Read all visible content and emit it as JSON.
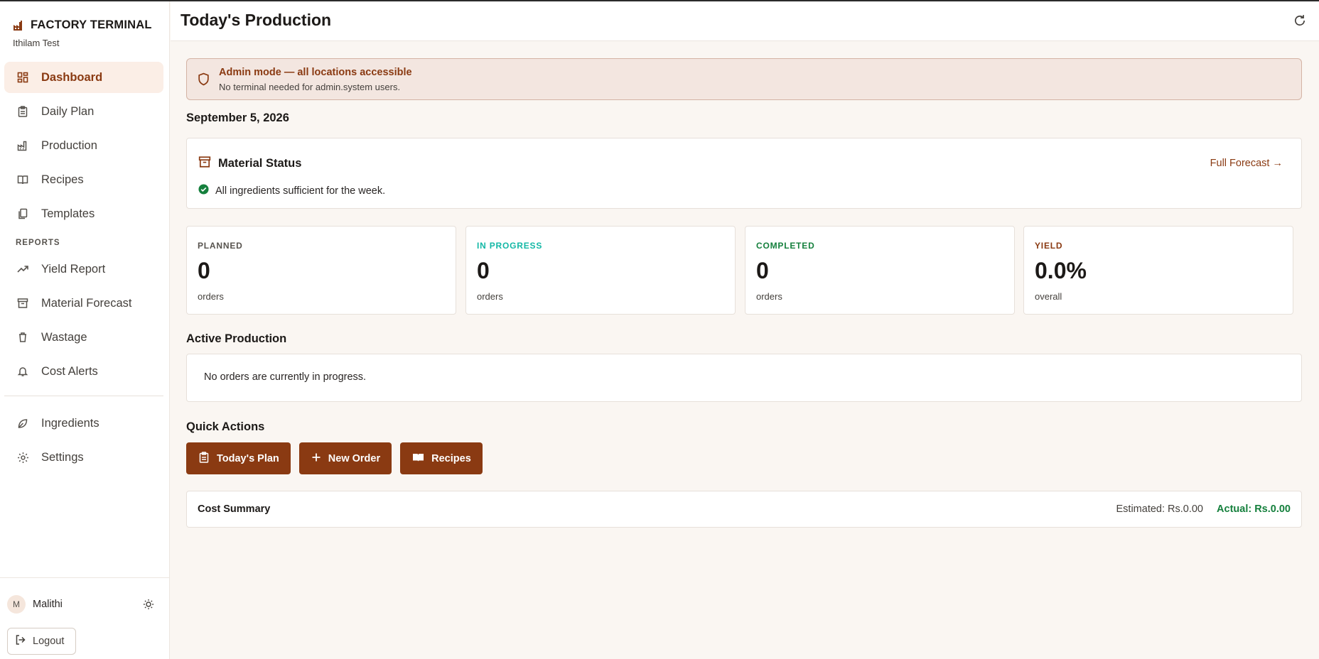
{
  "app": {
    "brand_title": "FACTORY TERMINAL",
    "location": "Ithilam Test"
  },
  "sidebar": {
    "main_items": [
      {
        "label": "Dashboard",
        "icon": "dashboard-icon",
        "active": true
      },
      {
        "label": "Daily Plan",
        "icon": "clipboard-icon"
      },
      {
        "label": "Production",
        "icon": "factory-icon"
      },
      {
        "label": "Recipes",
        "icon": "book-icon"
      },
      {
        "label": "Templates",
        "icon": "copy-icon"
      }
    ],
    "reports_label": "REPORTS",
    "report_items": [
      {
        "label": "Yield Report",
        "icon": "trending-up-icon"
      },
      {
        "label": "Material Forecast",
        "icon": "archive-icon"
      },
      {
        "label": "Wastage",
        "icon": "trash-icon"
      },
      {
        "label": "Cost Alerts",
        "icon": "bell-icon"
      }
    ],
    "other_items": [
      {
        "label": "Ingredients",
        "icon": "leaf-icon"
      },
      {
        "label": "Settings",
        "icon": "gear-icon"
      }
    ]
  },
  "user": {
    "initial": "M",
    "name": "Malithi",
    "logout_label": "Logout"
  },
  "header": {
    "title": "Today's Production"
  },
  "banner": {
    "title": "Admin mode — all locations accessible",
    "subtitle": "No terminal needed for admin.system users."
  },
  "date": "September 5, 2026",
  "material": {
    "title": "Material Status",
    "forecast_link": "Full Forecast →",
    "status": "All ingredients sufficient for the week."
  },
  "stats": [
    {
      "label": "PLANNED",
      "value": "0",
      "unit": "orders",
      "color": "#57534e"
    },
    {
      "label": "IN PROGRESS",
      "value": "0",
      "unit": "orders",
      "color": "#14b8a6"
    },
    {
      "label": "COMPLETED",
      "value": "0",
      "unit": "orders",
      "color": "#15803d"
    },
    {
      "label": "YIELD",
      "value": "0.0%",
      "unit": "overall",
      "color": "#8a3a12"
    }
  ],
  "active_production": {
    "title": "Active Production",
    "empty_text": "No orders are currently in progress."
  },
  "quick_actions": {
    "title": "Quick Actions",
    "buttons": [
      {
        "label": "Today's Plan",
        "icon": "clipboard-icon"
      },
      {
        "label": "New Order",
        "icon": "plus-icon"
      },
      {
        "label": "Recipes",
        "icon": "book-open-icon"
      }
    ]
  },
  "cost_summary": {
    "title": "Cost Summary",
    "estimated": "Estimated: Rs.0.00",
    "actual": "Actual: Rs.0.00"
  },
  "colors": {
    "accent": "#8a3a12",
    "success": "#15803d",
    "in_progress": "#14b8a6"
  }
}
